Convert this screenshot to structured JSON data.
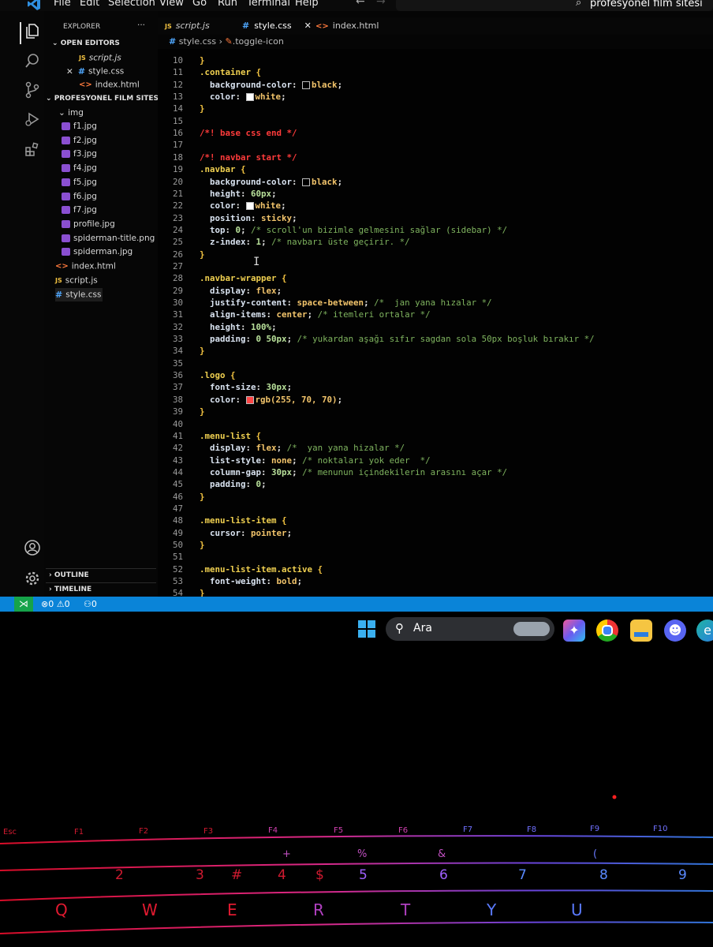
{
  "menubar": {
    "items": [
      "File",
      "Edit",
      "Selection",
      "View",
      "Go",
      "Run",
      "Terminal",
      "Help"
    ],
    "search": "profesyonel film sitesi"
  },
  "sidebar": {
    "explorer_title": "EXPLORER",
    "open_editors_title": "OPEN EDITORS",
    "open_editors": [
      {
        "name": "script.js",
        "type": "js"
      },
      {
        "name": "style.css",
        "type": "css"
      },
      {
        "name": "index.html",
        "type": "html"
      }
    ],
    "project_title": "PROFESYONEL FILM SITESI",
    "folder": "img",
    "images": [
      "f1.jpg",
      "f2.jpg",
      "f3.jpg",
      "f4.jpg",
      "f5.jpg",
      "f6.jpg",
      "f7.jpg",
      "profile.jpg",
      "spiderman-title.png",
      "spiderman.jpg"
    ],
    "root_files": [
      "index.html",
      "script.js",
      "style.css"
    ],
    "outline": "OUTLINE",
    "timeline": "TIMELINE"
  },
  "tabs": [
    {
      "name": "script.js",
      "type": "js"
    },
    {
      "name": "style.css",
      "type": "css"
    },
    {
      "name": "index.html",
      "type": "html"
    }
  ],
  "breadcrumb": {
    "file": "style.css",
    "symbol": ".toggle-icon"
  },
  "editor": {
    "lines": [
      {
        "n": 10,
        "text": "}"
      },
      {
        "n": 11,
        "text": ".container {"
      },
      {
        "n": 12,
        "text": "  background-color: black;"
      },
      {
        "n": 13,
        "text": "  color: white;"
      },
      {
        "n": 14,
        "text": "}"
      },
      {
        "n": 15,
        "text": ""
      },
      {
        "n": 16,
        "text": "/*! base css end */"
      },
      {
        "n": 17,
        "text": ""
      },
      {
        "n": 18,
        "text": "/*! navbar start */"
      },
      {
        "n": 19,
        "text": ".navbar {"
      },
      {
        "n": 20,
        "text": "  background-color: black;"
      },
      {
        "n": 21,
        "text": "  height: 60px;"
      },
      {
        "n": 22,
        "text": "  color: white;"
      },
      {
        "n": 23,
        "text": "  position: sticky;"
      },
      {
        "n": 24,
        "text": "  top: 0; /* scroll'un bizimle gelmesini sağlar (sidebar) */"
      },
      {
        "n": 25,
        "text": "  z-index: 1; /* navbarı üste geçirir. */"
      },
      {
        "n": 26,
        "text": "}"
      },
      {
        "n": 27,
        "text": ""
      },
      {
        "n": 28,
        "text": ".navbar-wrapper {"
      },
      {
        "n": 29,
        "text": "  display: flex;"
      },
      {
        "n": 30,
        "text": "  justify-content: space-between; /*  jan yana hızalar */"
      },
      {
        "n": 31,
        "text": "  align-items: center; /* itemleri ortalar */"
      },
      {
        "n": 32,
        "text": "  height: 100%;"
      },
      {
        "n": 33,
        "text": "  padding: 0 50px; /* yukardan aşağı sıfır sagdan sola 50px boşluk bırakır */"
      },
      {
        "n": 34,
        "text": "}"
      },
      {
        "n": 35,
        "text": ""
      },
      {
        "n": 36,
        "text": ".logo {"
      },
      {
        "n": 37,
        "text": "  font-size: 30px;"
      },
      {
        "n": 38,
        "text": "  color: rgb(255, 70, 70);"
      },
      {
        "n": 39,
        "text": "}"
      },
      {
        "n": 40,
        "text": ""
      },
      {
        "n": 41,
        "text": ".menu-list {"
      },
      {
        "n": 42,
        "text": "  display: flex; /*  yan yana hizalar */"
      },
      {
        "n": 43,
        "text": "  list-style: none; /* noktaları yok eder  */"
      },
      {
        "n": 44,
        "text": "  column-gap: 30px; /* menunun içindekilerin arasını açar */"
      },
      {
        "n": 45,
        "text": "  padding: 0;"
      },
      {
        "n": 46,
        "text": "}"
      },
      {
        "n": 47,
        "text": ""
      },
      {
        "n": 48,
        "text": ".menu-list-item {"
      },
      {
        "n": 49,
        "text": "  cursor: pointer;"
      },
      {
        "n": 50,
        "text": "}"
      },
      {
        "n": 51,
        "text": ""
      },
      {
        "n": 52,
        "text": ".menu-list-item.active {"
      },
      {
        "n": 53,
        "text": "  font-weight: bold;"
      },
      {
        "n": 54,
        "text": "}"
      }
    ]
  },
  "statusbar": {
    "errors": "0",
    "warnings": "0",
    "ports": "0"
  },
  "taskbar": {
    "search_label": "Ara"
  },
  "keyboard": {
    "fn_keys": [
      "Esc",
      "F1",
      "F2",
      "F3",
      "F4",
      "F5",
      "F6",
      "F7",
      "F8",
      "F9",
      "F10"
    ],
    "symbols": [
      "%",
      "&",
      "(",
      "+"
    ],
    "numbers": [
      "2",
      "3",
      "#",
      "4",
      "$",
      "5",
      "6",
      "7",
      "8",
      "9"
    ],
    "letters": [
      "Q",
      "W",
      "E",
      "R",
      "T",
      "Y",
      "U"
    ]
  },
  "colors": {
    "statusbar": "#0a84d8",
    "remote": "#16a34a",
    "selector": "#f0d050",
    "comment": "#7fb45f",
    "important_comment": "#ff3b3b",
    "logo_swatch": "#ff4646"
  }
}
